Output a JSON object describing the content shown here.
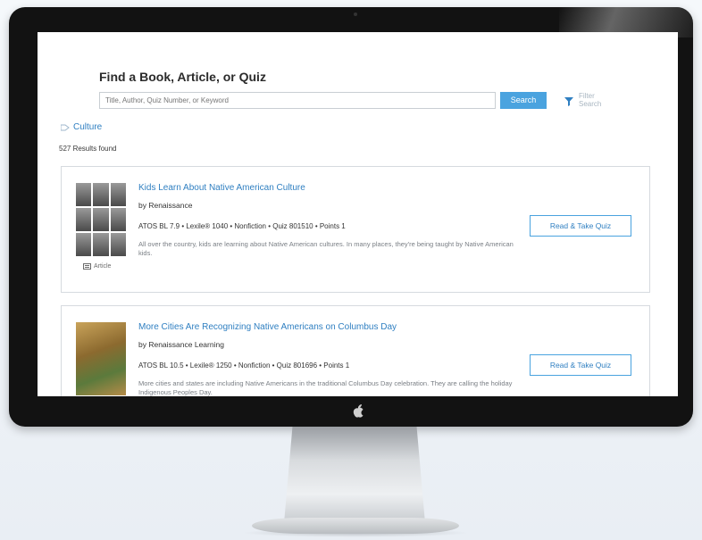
{
  "search": {
    "title": "Find a Book, Article, or Quiz",
    "placeholder": "Title, Author, Quiz Number, or Keyword",
    "button_label": "Search",
    "filter_label_line1": "Filter",
    "filter_label_line2": "Search"
  },
  "topic": {
    "label": "Culture"
  },
  "results": {
    "count_text": "527 Results found"
  },
  "items": [
    {
      "title": "Kids Learn About Native American Culture",
      "author": "by Renaissance",
      "meta": "ATOS BL 7.9 • Lexile® 1040 • Nonfiction • Quiz 801510 • Points 1",
      "description": "All over the country, kids are learning about Native American cultures. In many places, they're being taught by Native American kids.",
      "type_label": "Article",
      "action_label": "Read & Take Quiz"
    },
    {
      "title": "More Cities Are Recognizing Native Americans on Columbus Day",
      "author": "by Renaissance Learning",
      "meta": "ATOS BL 10.5 • Lexile® 1250 • Nonfiction • Quiz 801696 • Points 1",
      "description": "More cities and states are including Native Americans in the traditional Columbus Day celebration. They are calling the holiday Indigenous Peoples Day.",
      "action_label": "Read & Take Quiz"
    }
  ]
}
